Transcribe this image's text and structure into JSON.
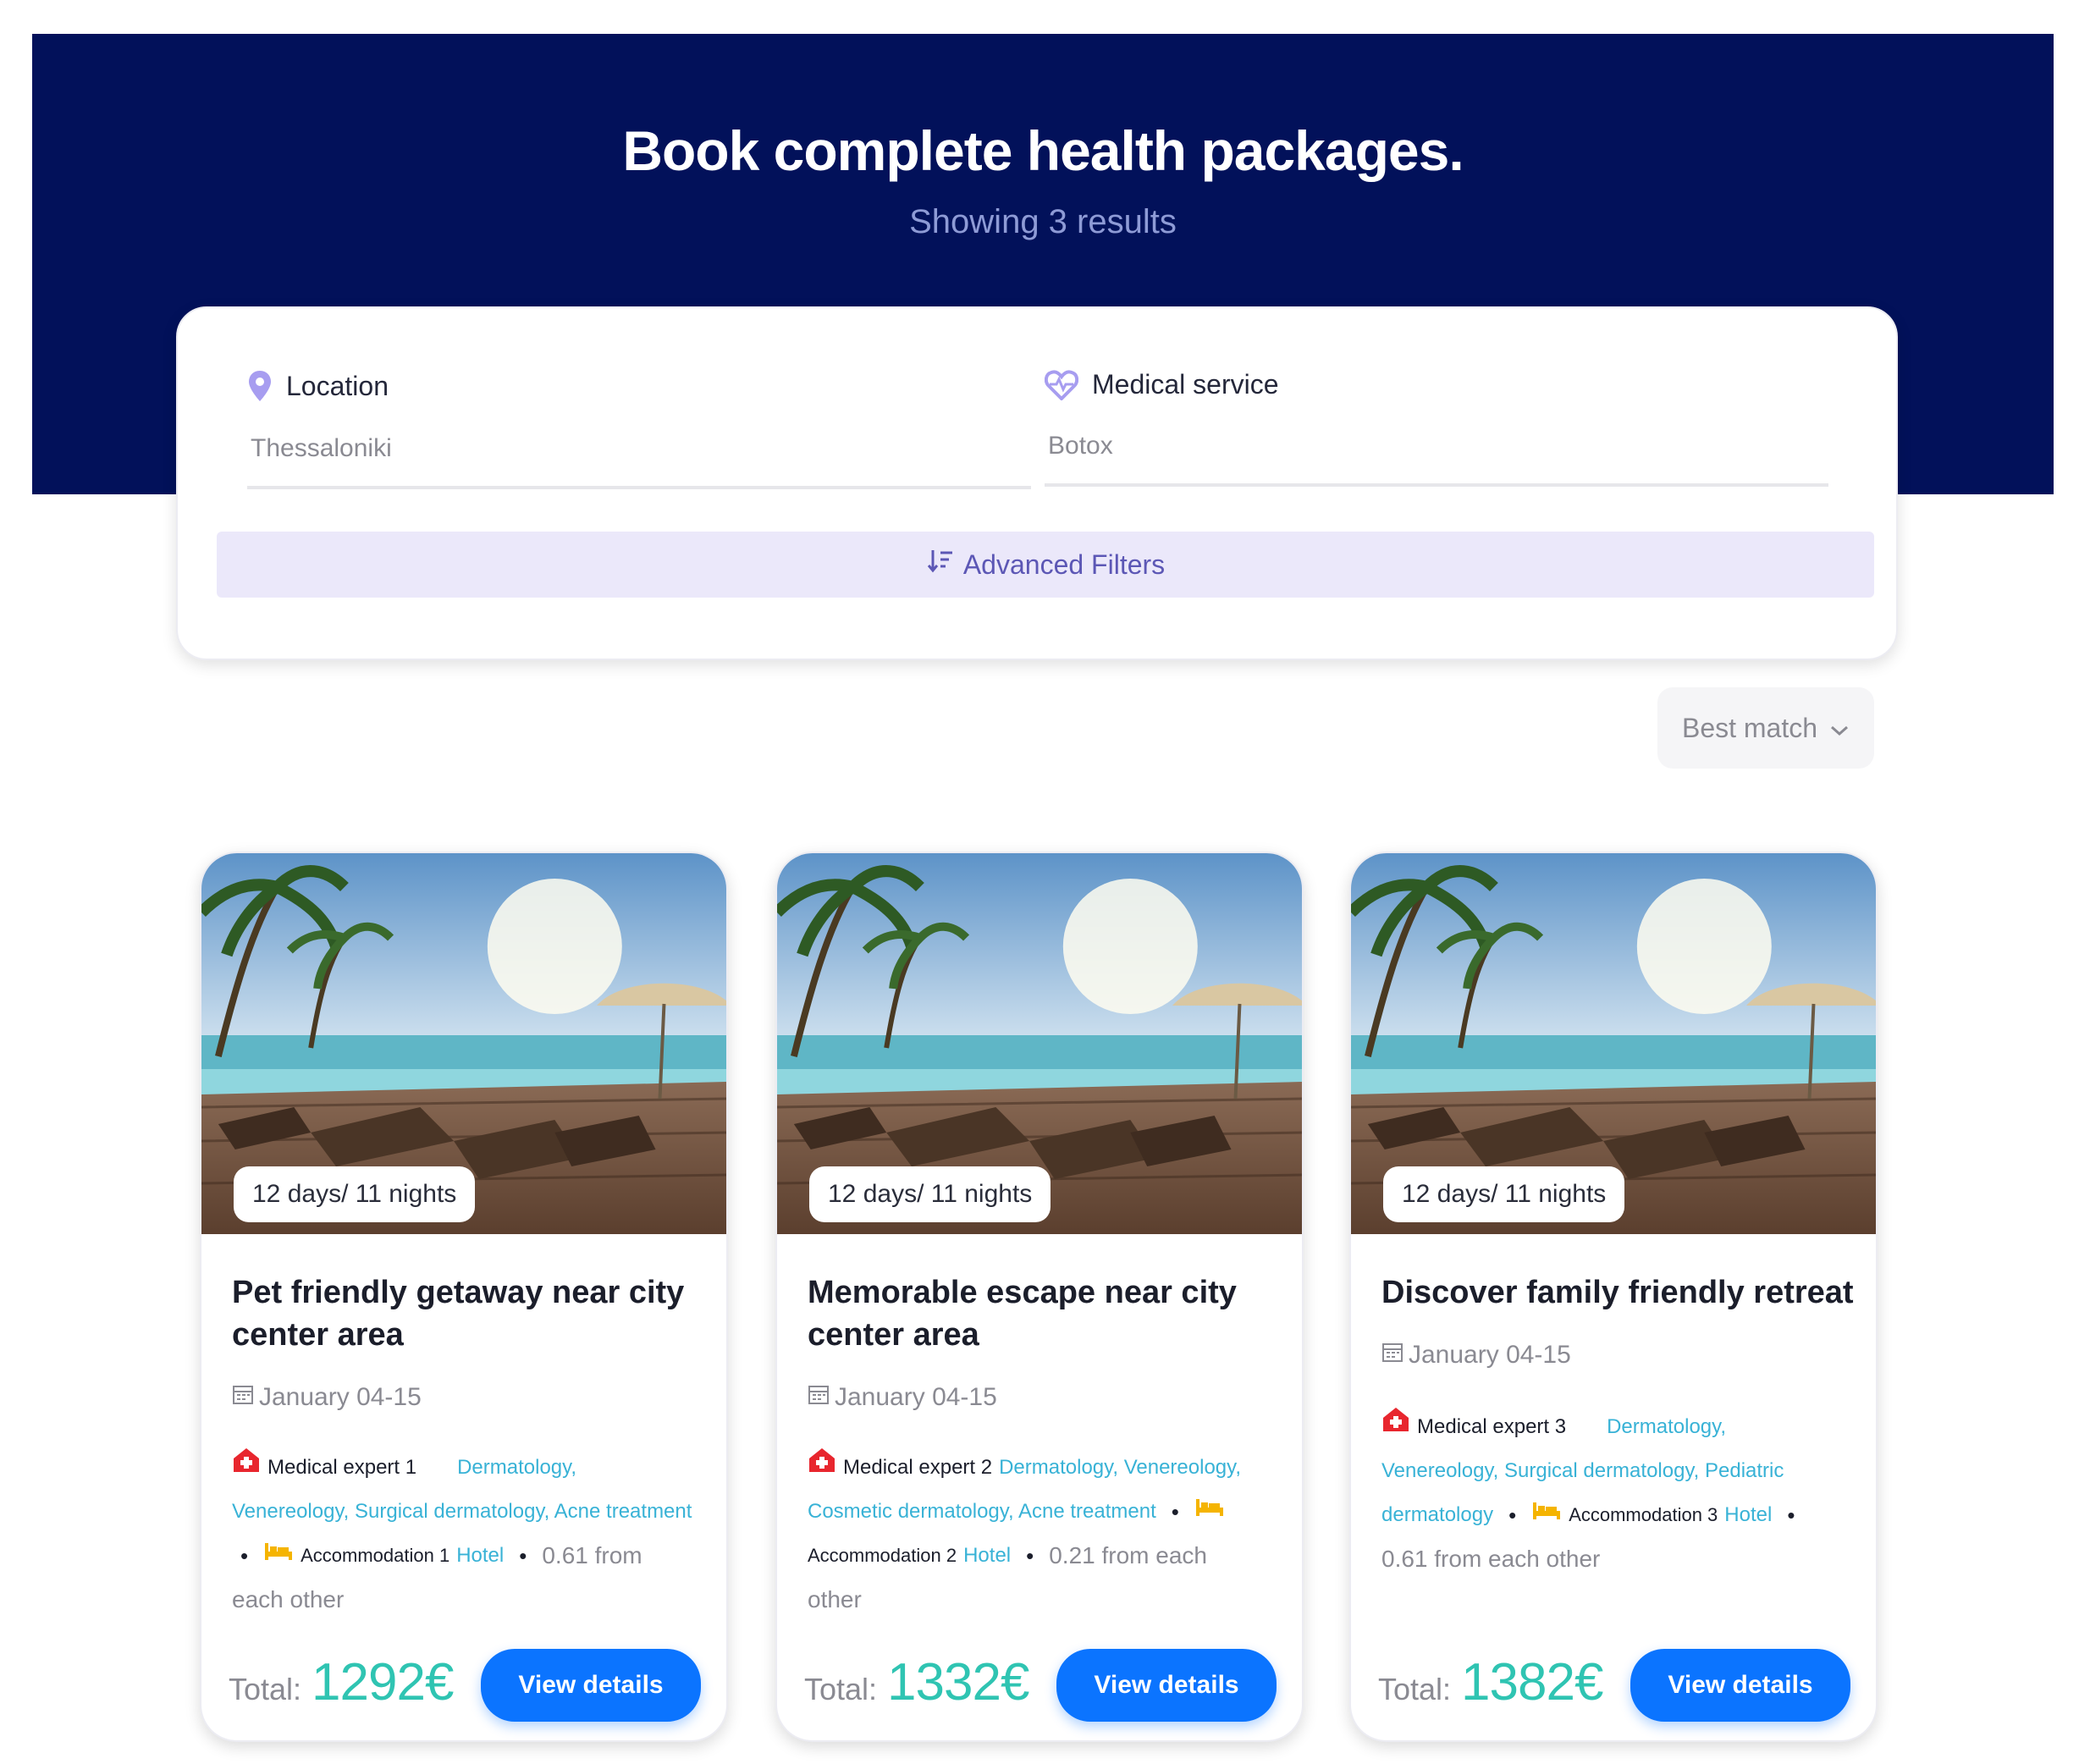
{
  "header": {
    "title": "Book complete health packages.",
    "subtitle": "Showing 3 results"
  },
  "search": {
    "location_label": "Location",
    "location_value": "Thessaloniki",
    "service_label": "Medical service",
    "service_value": "Botox",
    "advanced_filters": "Advanced Filters"
  },
  "sort": {
    "label": "Best match"
  },
  "cards": [
    {
      "duration": "12 days/ 11 nights",
      "title": "Pet friendly getaway near city center area",
      "date": "January 04-15",
      "expert": "Medical expert 1",
      "specialties": "Dermatology, Venereology, Surgical dermatology, Acne treatment",
      "spec_line1": "Dermatology,",
      "spec_line2": "Venereology, Surgical dermatology, Acne treatment",
      "accommodation": "Accommodation 1",
      "hotel": "Hotel",
      "distance": "0.61 from each other",
      "distance_line1": "0.61 from",
      "distance_line2": "each other",
      "total_label": "Total:",
      "price": "1292€",
      "button": "View details"
    },
    {
      "duration": "12 days/ 11 nights",
      "title": "Memorable escape near city center area",
      "date": "January 04-15",
      "expert": "Medical expert 2",
      "spec_line1": "Dermatology, Venereology,",
      "spec_line2": "Cosmetic dermatology, Acne treatment",
      "accommodation": "Accommodation 2",
      "hotel": "Hotel",
      "distance_line1": "0.21 from each",
      "distance_line2": "other",
      "total_label": "Total:",
      "price": "1332€",
      "button": "View details"
    },
    {
      "duration": "12 days/ 11 nights",
      "title": "Discover family friendly retreat",
      "date": "January 04-15",
      "expert": "Medical expert 3",
      "spec_line1": "Dermatology,",
      "spec_line2": "Venereology, Surgical dermatology, Pediatric",
      "spec_line3": "dermatology",
      "accommodation": "Accommodation 3",
      "hotel": "Hotel",
      "distance": "0.61 from each other",
      "total_label": "Total:",
      "price": "1382€",
      "button": "View details"
    }
  ],
  "colors": {
    "hero_bg": "#02115a",
    "accent_blue": "#0b74ff",
    "price_teal": "#2fc4b2",
    "filter_purple": "#5c57b5",
    "link_cyan": "#38b2d6"
  }
}
